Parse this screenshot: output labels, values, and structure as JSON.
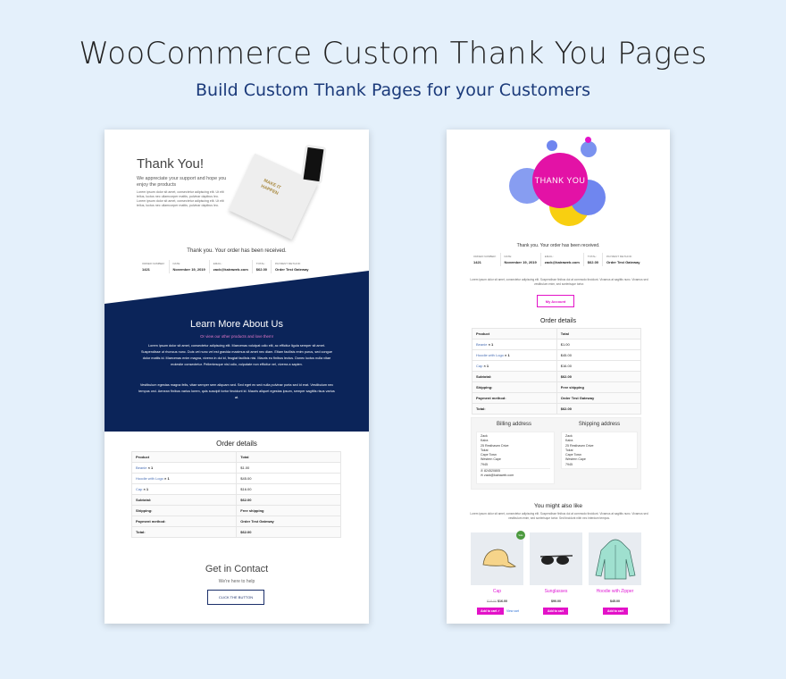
{
  "header": {
    "title": "WooCommerce Custom Thank You Pages",
    "subtitle": "Build Custom Thank Pages for your Customers"
  },
  "left_page": {
    "hero": {
      "title": "Thank You!",
      "subtitle": "We appreciate your support and hope you enjoy the products",
      "body": "Lorem ipsum dolor sit amet, consectetur adipiscing elit. Ut elit tellus, luctus nec ullamcorper mattis, pulvinar dapibus leo. Lorem ipsum dolor sit amet, consectetur adipiscing elit. Ut elit tellus, luctus nec ullamcorper mattis, pulvinar dapibus leo.",
      "image_text": "MAKE IT HAPPEN"
    },
    "received": "Thank you. Your order has been received.",
    "overview": [
      {
        "label": "ORDER NUMBER:",
        "value": "1421"
      },
      {
        "label": "DATE:",
        "value": "November 19, 2019"
      },
      {
        "label": "EMAIL:",
        "value": "zack@kairaweb.com"
      },
      {
        "label": "TOTAL:",
        "value": "$62.00"
      },
      {
        "label": "PAYMENT METHOD:",
        "value": "Order Test Gateway"
      }
    ],
    "about": {
      "title": "Learn More About Us",
      "subtitle": "Or view our other products and love them!",
      "p1": "Lorem ipsum dolor sit amet, consectetur adipiscing elit. Maecenas volutpat odio elit, ac efficitur ligula semper sit amet. Suspendisse ut rhoncus nunc. Duis vel nunc vel est gravida maximus sit amet nec diam. Etiam facilisis enim purus, sed congue dolor mattis id. Maecenas enim magna, viverra in dui id, feugiat facilisis nisi. Mauris eu finibus lectus. Donec luctus nulla vitae molestie consectetur. Pellentesque nisl odio, vulputate non efficitur vel, viverra a sapien.",
      "p2": "Vestibulum egestas magna felis, vitae semper sem aliquam sed. Sed eget ex sed nulla pulvinar porta sed id erat. Vestibulum nec tempus orci. Aenean finibus varius lorem, quis suscipit tortor tincidunt id. Mauris aliquet egestas ipsum, semper sagittis risus varius at.",
      "accent": "#e879c9",
      "bg": "#0b2459"
    },
    "order_details": {
      "title": "Order details",
      "header": [
        "Product",
        "Total"
      ],
      "items": [
        {
          "name": "Beanie",
          "qty": "× 1",
          "total": "$1.00"
        },
        {
          "name": "Hoodie with Logo",
          "qty": "× 1",
          "total": "$45.00"
        },
        {
          "name": "Cap",
          "qty": "× 1",
          "total": "$16.00"
        }
      ],
      "totals": [
        {
          "label": "Subtotal:",
          "value": "$62.00"
        },
        {
          "label": "Shipping:",
          "value": "Free shipping"
        },
        {
          "label": "Payment method:",
          "value": "Order Test Gateway"
        },
        {
          "label": "Total:",
          "value": "$62.00"
        }
      ]
    },
    "contact": {
      "title": "Get in Contact",
      "subtitle": "We're here to help",
      "button": "CLICK THE BUTTON"
    }
  },
  "right_page": {
    "badge": "THANK YOU",
    "received": "Thank you. Your order has been received.",
    "overview": [
      {
        "label": "ORDER NUMBER:",
        "value": "1421"
      },
      {
        "label": "DATE:",
        "value": "November 19, 2019"
      },
      {
        "label": "EMAIL:",
        "value": "zack@kairaweb.com"
      },
      {
        "label": "TOTAL:",
        "value": "$62.00"
      },
      {
        "label": "PAYMENT METHOD:",
        "value": "Order Test Gateway"
      }
    ],
    "intro": "Lorem ipsum dolor sit amet, consectetur adipiscing elit. Suspendisse finibus dui at commodo tincidunt. Vivamus at sagittis nunc. Vivamus sed vestibulum enim, sed scelerisque tortor.",
    "my_account": "My Account",
    "order_details": {
      "title": "Order details",
      "header": [
        "Product",
        "Total"
      ],
      "items": [
        {
          "name": "Beanie",
          "qty": "× 1",
          "total": "$1.00"
        },
        {
          "name": "Hoodie with Logo",
          "qty": "× 1",
          "total": "$45.00"
        },
        {
          "name": "Cap",
          "qty": "× 1",
          "total": "$16.00"
        }
      ],
      "totals": [
        {
          "label": "Subtotal:",
          "value": "$62.00"
        },
        {
          "label": "Shipping:",
          "value": "Free shipping"
        },
        {
          "label": "Payment method:",
          "value": "Order Test Gateway"
        },
        {
          "label": "Total:",
          "value": "$62.00"
        }
      ]
    },
    "billing": {
      "title": "Billing address",
      "lines": "Zack\nKaira\n25 Resthaven Drive\nTokai\nCape Town\nWestern Cape\n7945",
      "phone": "824520805",
      "email": "zack@kairaweb.com"
    },
    "shipping": {
      "title": "Shipping address",
      "lines": "Zack\nKaira\n25 Resthaven Drive\nTokai\nCape Town\nWestern Cape\n7945"
    },
    "upsell": {
      "title": "You might also like",
      "text": "Lorem ipsum dolor sit amet, consectetur adipiscing elit. Suspendisse finibus dui at commodo tincidunt. Vivamus at sagittis nunc. Vivamus sed vestibulum enim, sed scelerisque tortor. Sed tincidunt nibh nec interdum tempus.",
      "products": [
        {
          "name": "Cap",
          "old_price": "$18.00",
          "price": "$16.00",
          "button": "Add to cart ✓",
          "view_cart": "View cart",
          "badge": "Sale"
        },
        {
          "name": "Sunglasses",
          "price": "$90.00",
          "button": "Add to cart"
        },
        {
          "name": "Hoodie with Zipper",
          "price": "$45.00",
          "button": "Add to cart"
        }
      ]
    },
    "accent": "#e312c8"
  }
}
